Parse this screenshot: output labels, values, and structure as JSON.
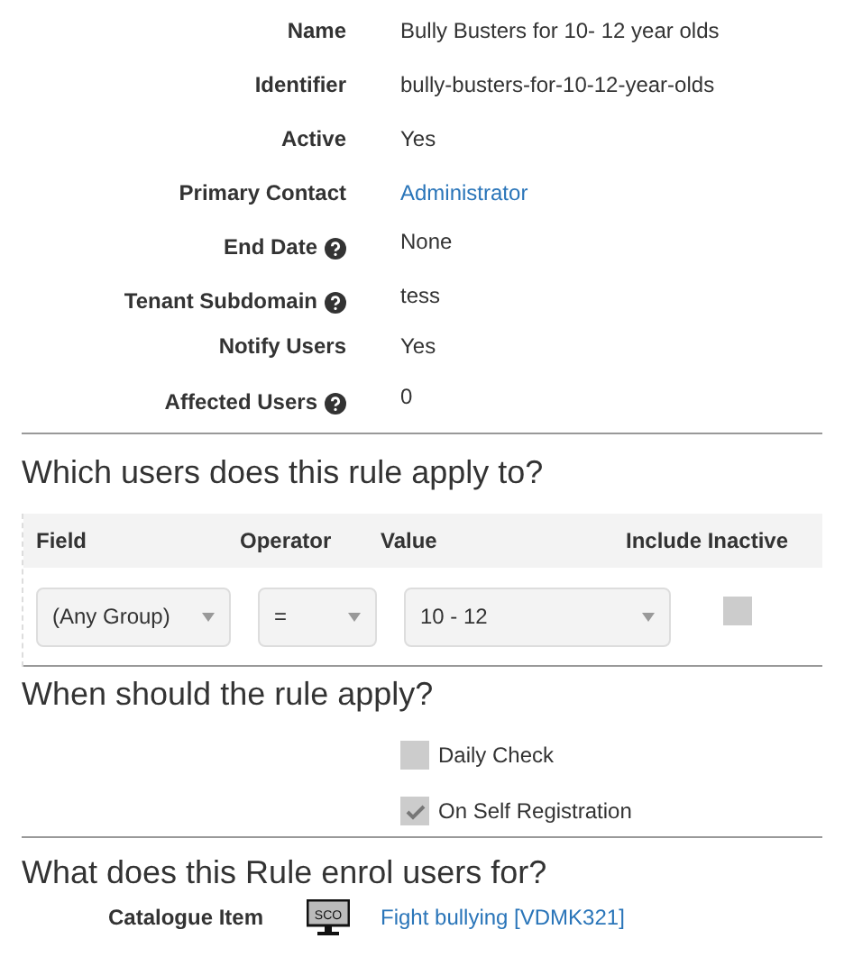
{
  "details": [
    {
      "label": "Name",
      "value": "Bully Busters for 10- 12 year olds",
      "kind": "text",
      "help": false
    },
    {
      "label": "Identifier",
      "value": "bully-busters-for-10-12-year-olds",
      "kind": "text",
      "help": false
    },
    {
      "label": "Active",
      "value": "Yes",
      "kind": "text",
      "help": false
    },
    {
      "label": "Primary Contact",
      "value": "Administrator",
      "kind": "link",
      "help": false
    },
    {
      "label": "End Date",
      "value": "None",
      "kind": "text",
      "help": true
    },
    {
      "label": "Tenant Subdomain",
      "value": "tess",
      "kind": "text",
      "help": true
    },
    {
      "label": "Notify Users",
      "value": "Yes",
      "kind": "text",
      "help": false
    },
    {
      "label": "Affected Users",
      "value": "0",
      "kind": "text",
      "help": true
    }
  ],
  "users_section": {
    "heading": "Which users does this rule apply to?",
    "columns": [
      "Field",
      "Operator",
      "Value",
      "Include Inactive"
    ],
    "row": {
      "field": "(Any Group)",
      "operator": "=",
      "value": "10 - 12",
      "include_inactive": false
    }
  },
  "when_section": {
    "heading": "When should the rule apply?",
    "options": [
      {
        "label": "Daily Check",
        "checked": false
      },
      {
        "label": "On Self Registration",
        "checked": true
      }
    ]
  },
  "enrol_section": {
    "heading": "What does this Rule enrol users for?",
    "label": "Catalogue Item",
    "icon_text": "SCO",
    "item": "Fight bullying [VDMK321]"
  }
}
